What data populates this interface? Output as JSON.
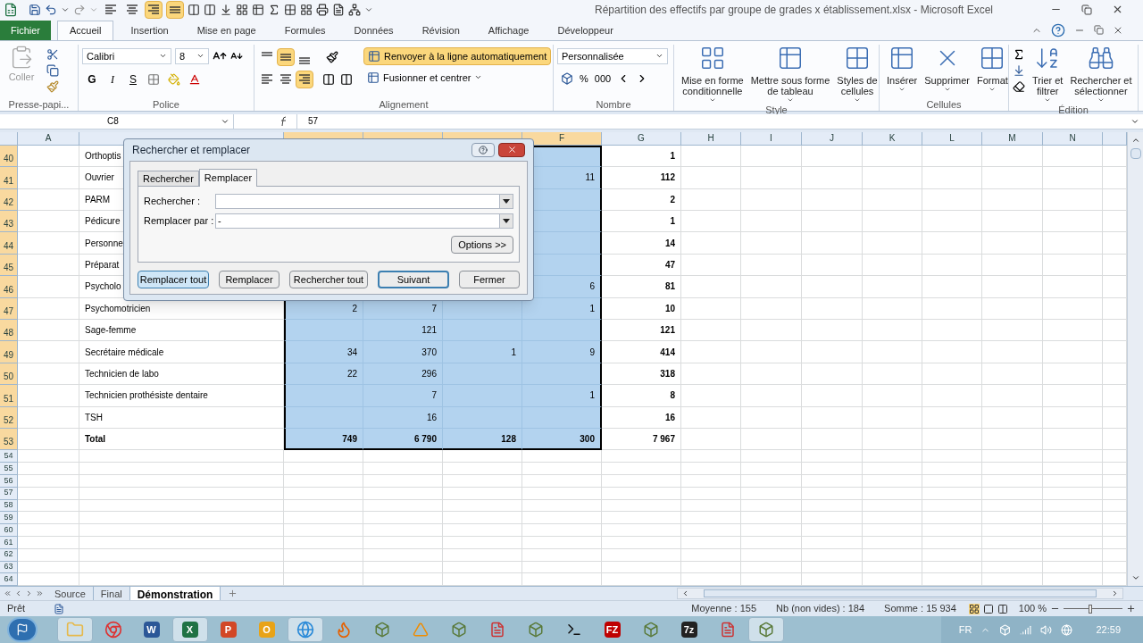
{
  "window": {
    "title": "Répartition des effectifs par groupe de grades x établissement.xlsx  -  Microsoft Excel"
  },
  "quick_access": {
    "align": [
      {
        "selected": false
      },
      {
        "selected": false
      },
      {
        "selected": true
      },
      {
        "selected": true
      }
    ]
  },
  "ribbon_tabs": [
    {
      "label": "Fichier",
      "kind": "file",
      "selected": false
    },
    {
      "label": "Accueil",
      "kind": "tab",
      "selected": true
    },
    {
      "label": "Insertion",
      "kind": "tab",
      "selected": false
    },
    {
      "label": "Mise en page",
      "kind": "tab",
      "selected": false
    },
    {
      "label": "Formules",
      "kind": "tab",
      "selected": false
    },
    {
      "label": "Données",
      "kind": "tab",
      "selected": false
    },
    {
      "label": "Révision",
      "kind": "tab",
      "selected": false
    },
    {
      "label": "Affichage",
      "kind": "tab",
      "selected": false
    },
    {
      "label": "Développeur",
      "kind": "tab",
      "selected": false
    }
  ],
  "ribbon": {
    "clipboard": {
      "paste": "Coller",
      "title": "Presse-papi..."
    },
    "font": {
      "name": "Calibri",
      "size": "8",
      "bold": "G",
      "italic": "I",
      "underline": "S",
      "title": "Police"
    },
    "alignment": {
      "vertical": [
        {
          "selected": false
        },
        {
          "selected": true
        },
        {
          "selected": false
        }
      ],
      "horizontal": [
        {
          "selected": false
        },
        {
          "selected": false
        },
        {
          "selected": true
        }
      ],
      "wrap": {
        "label": "Renvoyer à la ligne automatiquement",
        "selected": true
      },
      "merge": "Fusionner et centrer",
      "title": "Alignement"
    },
    "number": {
      "format": "Personnalisée",
      "percent": "%",
      "thousands": "000",
      "title": "Nombre"
    },
    "style": {
      "buttons": [
        {
          "lines": [
            "Mise en forme",
            "conditionnelle"
          ]
        },
        {
          "lines": [
            "Mettre sous forme",
            "de tableau"
          ]
        },
        {
          "lines": [
            "Styles de",
            "cellules"
          ]
        }
      ],
      "title": "Style"
    },
    "cells": {
      "buttons": [
        {
          "label": "Insérer"
        },
        {
          "label": "Supprimer"
        },
        {
          "label": "Format"
        }
      ],
      "title": "Cellules"
    },
    "editing": {
      "buttons": [
        {
          "lines": [
            "Trier et",
            "filtrer"
          ]
        },
        {
          "lines": [
            "Rechercher et",
            "sélectionner"
          ]
        }
      ],
      "title": "Édition"
    }
  },
  "formula_bar": {
    "name_box": "C8",
    "formula": "57"
  },
  "columns": [
    {
      "label": "A",
      "selected": false
    },
    {
      "selected": false
    },
    {
      "selected": true
    },
    {
      "selected": true
    },
    {
      "selected": true
    },
    {
      "label": "F",
      "selected": true
    },
    {
      "label": "G",
      "selected": false
    },
    {
      "label": "H",
      "selected": false
    },
    {
      "label": "I",
      "selected": false
    },
    {
      "label": "J",
      "selected": false
    },
    {
      "label": "K",
      "selected": false
    },
    {
      "label": "L",
      "selected": false
    },
    {
      "label": "M",
      "selected": false
    },
    {
      "label": "N",
      "selected": false
    },
    {
      "selected": false
    }
  ],
  "rows": [
    {
      "number": "40",
      "selected": true,
      "kind": "data",
      "cells": {
        "b": "Orthoptis",
        "g": "1"
      }
    },
    {
      "number": "41",
      "selected": true,
      "kind": "data",
      "cells": {
        "b": "Ouvrier",
        "f": "11",
        "g": "112"
      }
    },
    {
      "number": "42",
      "selected": true,
      "kind": "data",
      "cells": {
        "b": "PARM",
        "g": "2"
      }
    },
    {
      "number": "43",
      "selected": true,
      "kind": "data",
      "cells": {
        "b": "Pédicure",
        "g": "1"
      }
    },
    {
      "number": "44",
      "selected": true,
      "kind": "data",
      "cells": {
        "b": "Personne",
        "g": "14"
      }
    },
    {
      "number": "45",
      "selected": true,
      "kind": "data",
      "cells": {
        "b": "Préparat",
        "g": "47"
      }
    },
    {
      "number": "46",
      "selected": true,
      "kind": "data",
      "cells": {
        "b": "Psycholo",
        "f": "6",
        "g": "81"
      }
    },
    {
      "number": "47",
      "selected": true,
      "kind": "data",
      "cells": {
        "b": "Psychomotricien",
        "c": "2",
        "d": "7",
        "f": "1",
        "g": "10"
      }
    },
    {
      "number": "48",
      "selected": true,
      "kind": "data",
      "cells": {
        "b": "Sage-femme",
        "d": "121",
        "g": "121"
      }
    },
    {
      "number": "49",
      "selected": true,
      "kind": "data",
      "cells": {
        "b": "Secrétaire médicale",
        "c": "34",
        "d": "370",
        "e": "1",
        "f": "9",
        "g": "414"
      }
    },
    {
      "number": "50",
      "selected": true,
      "kind": "data",
      "cells": {
        "b": "Technicien de labo",
        "c": "22",
        "d": "296",
        "g": "318"
      }
    },
    {
      "number": "51",
      "selected": true,
      "kind": "data",
      "cells": {
        "b": "Technicien prothésiste dentaire",
        "d": "7",
        "f": "1",
        "g": "8"
      }
    },
    {
      "number": "52",
      "selected": true,
      "kind": "data",
      "cells": {
        "b": "TSH",
        "d": "16",
        "g": "16"
      }
    },
    {
      "number": "53",
      "selected": true,
      "kind": "total",
      "cells": {
        "b": "Total",
        "c": "749",
        "d": "6 790",
        "e": "128",
        "f": "300",
        "g": "7 967"
      }
    }
  ],
  "empty_rows": [
    "54",
    "55",
    "56",
    "57",
    "58",
    "59",
    "60",
    "61",
    "62",
    "63",
    "64"
  ],
  "dialog": {
    "title": "Rechercher et remplacer",
    "tabs": [
      {
        "label": "Rechercher",
        "selected": false
      },
      {
        "label": "Remplacer",
        "selected": true
      }
    ],
    "fields": [
      {
        "label": "Rechercher :"
      },
      {
        "label": "Remplacer par :",
        "value": "-"
      }
    ],
    "options": "Options >>",
    "buttons": [
      {
        "label": "Remplacer tout",
        "hover": true,
        "default": false
      },
      {
        "label": "Remplacer",
        "hover": false,
        "default": false
      },
      {
        "label": "Rechercher tout",
        "hover": false,
        "default": false
      },
      {
        "label": "Suivant",
        "hover": false,
        "default": true
      },
      {
        "label": "Fermer",
        "hover": false,
        "default": false
      }
    ]
  },
  "sheet_tabs": [
    {
      "label": "Source",
      "selected": false
    },
    {
      "label": "Final",
      "selected": false
    },
    {
      "label": "Démonstration",
      "selected": true
    }
  ],
  "status_bar": {
    "ready": "Prêt",
    "stats": [
      "Moyenne : 155",
      "Nb (non vides) : 184",
      "Somme : 15 934"
    ],
    "zoom": "100 %",
    "level": 0.45
  },
  "taskbar": {
    "apps": [
      {
        "kind": "folder",
        "running": true
      },
      {
        "kind": "browser",
        "running": false
      },
      {
        "kind": "letter",
        "text": "W",
        "color": "#2b5797",
        "running": false
      },
      {
        "kind": "letter",
        "text": "X",
        "color": "#1f7244",
        "running": true
      },
      {
        "kind": "letter",
        "text": "P",
        "color": "#d24726",
        "running": false
      },
      {
        "kind": "letter",
        "text": "O",
        "color": "#e8a317",
        "running": false
      },
      {
        "kind": "globe",
        "running": true
      },
      {
        "kind": "firefox",
        "running": false
      },
      {
        "kind": "generic",
        "running": false
      },
      {
        "kind": "cone",
        "running": false
      },
      {
        "kind": "generic",
        "running": false
      },
      {
        "kind": "file",
        "running": false
      },
      {
        "kind": "generic",
        "running": false
      },
      {
        "kind": "terminal",
        "running": false
      },
      {
        "kind": "letter",
        "text": "FZ",
        "color": "#bf0000",
        "running": false
      },
      {
        "kind": "generic",
        "running": false
      },
      {
        "kind": "letter",
        "text": "7z",
        "color": "#222222",
        "running": false
      },
      {
        "kind": "file",
        "running": false
      },
      {
        "kind": "generic",
        "running": true
      }
    ],
    "language": "FR",
    "time": "22:59"
  }
}
